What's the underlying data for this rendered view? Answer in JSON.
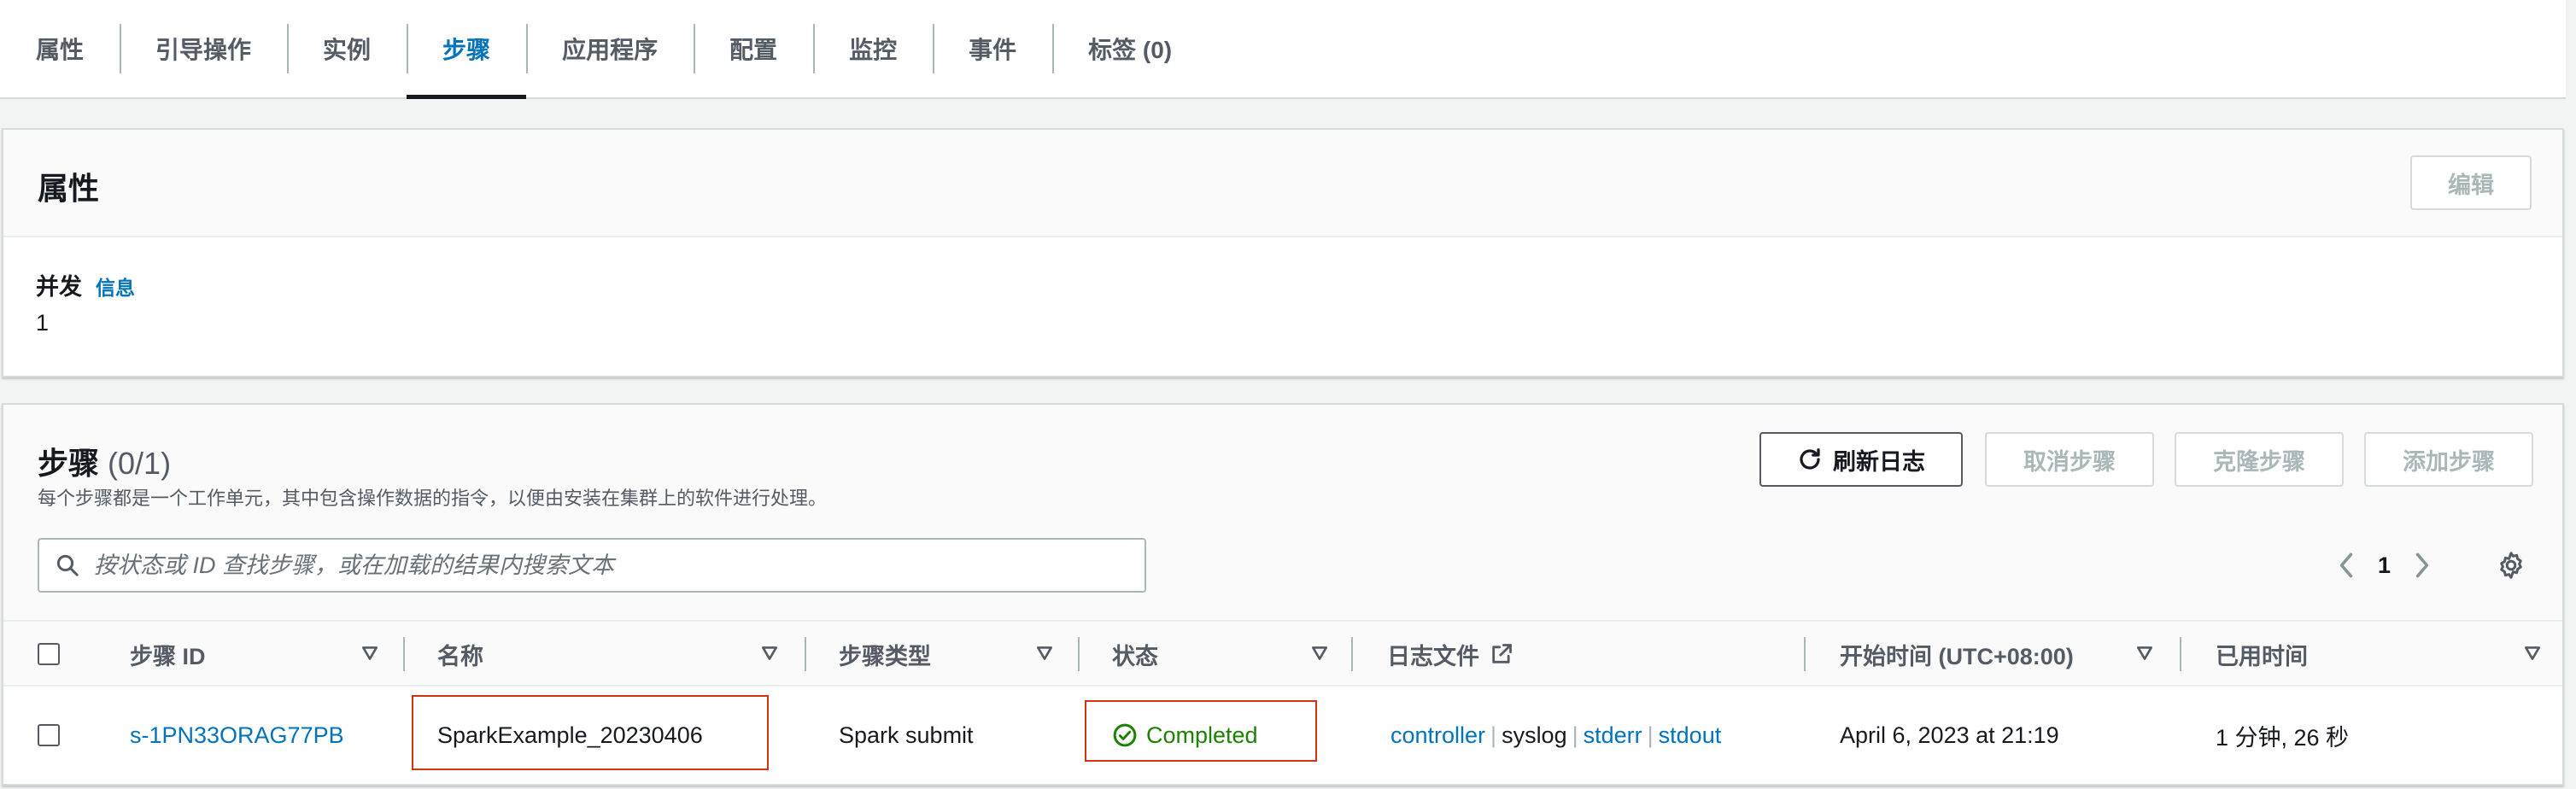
{
  "tabs": [
    {
      "label": "属性",
      "active": false
    },
    {
      "label": "引导操作",
      "active": false
    },
    {
      "label": "实例",
      "active": false
    },
    {
      "label": "步骤",
      "active": true
    },
    {
      "label": "应用程序",
      "active": false
    },
    {
      "label": "配置",
      "active": false
    },
    {
      "label": "监控",
      "active": false
    },
    {
      "label": "事件",
      "active": false
    },
    {
      "label": "标签 (0)",
      "active": false
    }
  ],
  "properties": {
    "title": "属性",
    "edit_label": "编辑",
    "concurrency_label": "并发",
    "info_label": "信息",
    "concurrency_value": "1"
  },
  "steps": {
    "title": "步骤",
    "count": "(0/1)",
    "description": "每个步骤都是一个工作单元，其中包含操作数据的指令，以便由安装在集群上的软件进行处理。",
    "refresh_label": "刷新日志",
    "cancel_label": "取消步骤",
    "clone_label": "克隆步骤",
    "add_label": "添加步骤",
    "search_placeholder": "按状态或 ID 查找步骤，或在加载的结果内搜索文本",
    "page": "1",
    "columns": {
      "id": "步骤 ID",
      "name": "名称",
      "type": "步骤类型",
      "status": "状态",
      "logs": "日志文件",
      "start": "开始时间 (UTC+08:00)",
      "elapsed": "已用时间"
    },
    "rows": [
      {
        "id": "s-1PN33ORAG77PB",
        "name": "SparkExample_20230406",
        "type": "Spark submit",
        "status": "Completed",
        "logs": [
          "controller",
          "syslog",
          "stderr",
          "stdout"
        ],
        "start": "April 6, 2023 at 21:19",
        "elapsed": "1 分钟, 26 秒"
      }
    ]
  },
  "colors": {
    "link": "#0073bb",
    "success": "#1d8102",
    "highlight": "#d13212",
    "disabled": "#aab7b8"
  }
}
